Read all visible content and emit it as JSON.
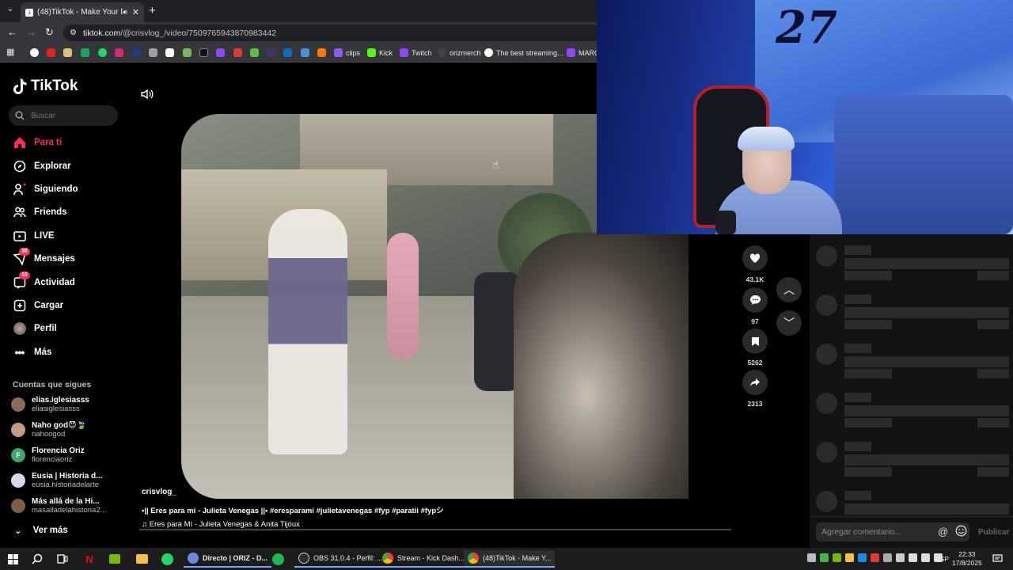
{
  "browser": {
    "tab_title": "(48)TikTok - Make Your Day",
    "url_host": "tiktok.com",
    "url_path": "/@crisvlog_/video/7509765943870983442",
    "bookmarks": [
      "clips",
      "Kick",
      "Twitch",
      "orizmerch",
      "The best streaming...",
      "MARCO"
    ]
  },
  "tiktok": {
    "brand": "TikTok",
    "search_placeholder": "Buscar",
    "nav": [
      {
        "label": "Para ti",
        "badge": ""
      },
      {
        "label": "Explorar",
        "badge": ""
      },
      {
        "label": "Siguiendo",
        "badge": ""
      },
      {
        "label": "Friends",
        "badge": ""
      },
      {
        "label": "LIVE",
        "badge": ""
      },
      {
        "label": "Mensajes",
        "badge": "38"
      },
      {
        "label": "Actividad",
        "badge": "10"
      },
      {
        "label": "Cargar",
        "badge": ""
      },
      {
        "label": "Perfil",
        "badge": ""
      },
      {
        "label": "Más",
        "badge": ""
      }
    ],
    "following_title": "Cuentas que sigues",
    "following": [
      {
        "name": "elias.iglesiasss",
        "handle": "eliasiglesiasss",
        "avatar_color": "#8a6a5c"
      },
      {
        "name": "Naho god😈🍃",
        "handle": "nahoogod",
        "avatar_color": "#c49a8a"
      },
      {
        "name": "Florencia Oriz",
        "handle": "florenciaoriz",
        "avatar_color": "#3fa66b",
        "initial": "F"
      },
      {
        "name": "Eusia | Historia d...",
        "handle": "eusia.historiadelarte",
        "avatar_color": "#dcd8e8"
      },
      {
        "name": "Más allá de la Hi...",
        "handle": "masalladelahistoria2...",
        "avatar_color": "#7a5e4a"
      }
    ],
    "see_more": "Ver más",
    "video": {
      "author": "crisvlog_",
      "caption": "•|| Eres para mí - Julieta Venegas ||• #eresparami #julietavenegas #fyp #paratii #fypシ",
      "music": "Eres para Mí - Julieta Venegas & Anita Tijoux"
    },
    "actions": [
      {
        "icon": "heart-icon",
        "count": "43.1K"
      },
      {
        "icon": "comment-icon",
        "count": "97"
      },
      {
        "icon": "bookmark-icon",
        "count": "5262"
      },
      {
        "icon": "share-icon",
        "count": "2313"
      }
    ],
    "comment_placeholder": "Agregar comentario...",
    "publish_label": "Publicar"
  },
  "webcam": {
    "logo_text": "27"
  },
  "taskbar": {
    "apps": [
      "Directo | ORIZ - D...",
      "OBS 31.0.4 - Perfil: ...",
      "Stream - Kick Dash...",
      "(48)TikTok - Make Y..."
    ],
    "lang": "ESP",
    "time": "22:33",
    "date": "17/8/2025"
  }
}
